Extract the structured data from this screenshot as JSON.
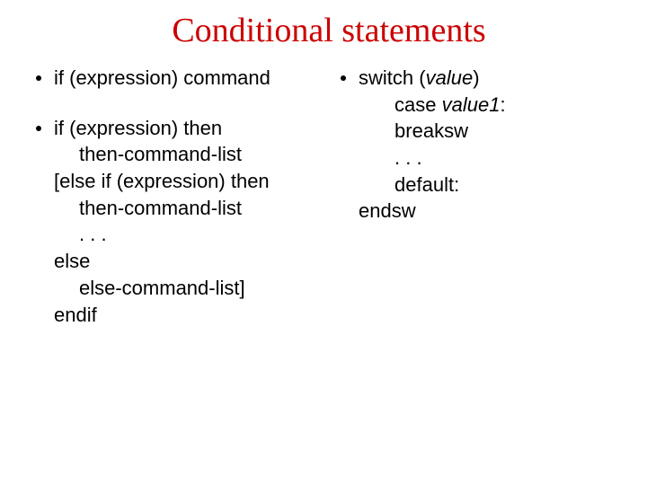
{
  "title": "Conditional statements",
  "left": {
    "item1": "if (expression) command",
    "item2": {
      "l0": "if (expression) then",
      "l1": "then-command-list",
      "l2": "[else if (expression) then",
      "l3": "then-command-list",
      "l4": ". . .",
      "l5": "else",
      "l6": "else-command-list]",
      "l7": "endif"
    }
  },
  "right": {
    "item1": {
      "l0a": "switch (",
      "l0b": "value",
      "l0c": ")",
      "l1a": "case ",
      "l1b": "value1",
      "l1c": ":",
      "l2": "breaksw",
      "l3": ". . .",
      "l4": "default:",
      "l5": "endsw"
    }
  }
}
